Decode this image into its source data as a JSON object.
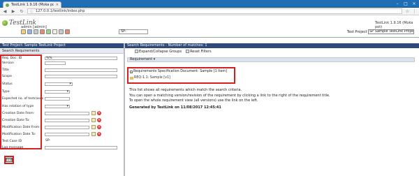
{
  "browser": {
    "tab_title": "TestLink 1.9.16 (Moka pot)",
    "url": "127.0.0.1/testlink/index.php"
  },
  "header": {
    "logo_text": "TestLink",
    "user": "admin [admin]",
    "search_value": "SP-",
    "version": "TestLink 1.9.16 (Moka pot)",
    "project_label": "Test Project",
    "project_value": "SP Sample TestLink Project"
  },
  "left": {
    "title": "Test Project: Sample TestLink Project",
    "subtitle": "Search Requirements",
    "fields": {
      "req_doc_id": "Req. Doc. ID",
      "req_doc_id_value": "%%",
      "version": "Version",
      "title": "Title",
      "scope": "Scope",
      "status": "Status",
      "type": "Type",
      "expected_tc": "Expected no. of testcases",
      "has_relation": "Has relation of type",
      "creation_from": "Creation Date From:",
      "creation_to": "Creation Date To:",
      "modification_from": "Modification Date From:",
      "modification_to": "Modification Date To:",
      "test_case_id": "Test Case ID",
      "test_case_id_value": "SP-",
      "log_message": "Log message"
    },
    "find_label": "Find"
  },
  "right": {
    "title": "Search Requirements - Number of matches: 1",
    "tools": {
      "expand_label": "Expand/Collapse Groups",
      "reset_label": "Reset Filters"
    },
    "req_bar": "Requirement ▾",
    "tree": {
      "group": "Requirements Specification Document: Sample [1 Item]",
      "item": "REQ-1.1: Sample [v1]"
    },
    "info_lines": [
      "This list shows all requirements which match the search criteria.",
      "You can open a matching version/revision of the requirement by clicking a link to the right of the requirement title.",
      "To open the whole requirement view (all versions) use the link on the left."
    ],
    "generated": "Generated by TestLink on 11/08/2017 12:45:41"
  }
}
